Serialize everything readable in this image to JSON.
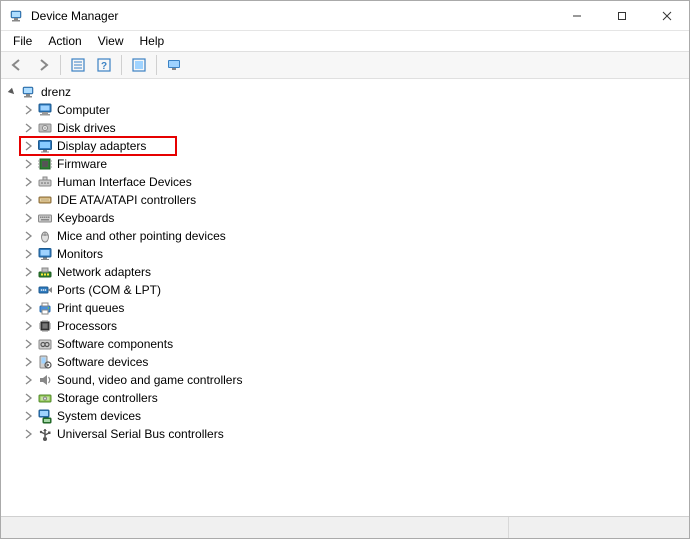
{
  "window": {
    "title": "Device Manager"
  },
  "menu": {
    "file": "File",
    "action": "Action",
    "view": "View",
    "help": "Help"
  },
  "tree": {
    "root": "drenz",
    "highlighted_index": 2,
    "items": [
      {
        "label": "Computer",
        "icon": "computer"
      },
      {
        "label": "Disk drives",
        "icon": "disk"
      },
      {
        "label": "Display adapters",
        "icon": "display"
      },
      {
        "label": "Firmware",
        "icon": "firmware"
      },
      {
        "label": "Human Interface Devices",
        "icon": "hid"
      },
      {
        "label": "IDE ATA/ATAPI controllers",
        "icon": "ide"
      },
      {
        "label": "Keyboards",
        "icon": "keyboard"
      },
      {
        "label": "Mice and other pointing devices",
        "icon": "mouse"
      },
      {
        "label": "Monitors",
        "icon": "monitor"
      },
      {
        "label": "Network adapters",
        "icon": "network"
      },
      {
        "label": "Ports (COM & LPT)",
        "icon": "port"
      },
      {
        "label": "Print queues",
        "icon": "printer"
      },
      {
        "label": "Processors",
        "icon": "cpu"
      },
      {
        "label": "Software components",
        "icon": "swcomp"
      },
      {
        "label": "Software devices",
        "icon": "swdev"
      },
      {
        "label": "Sound, video and game controllers",
        "icon": "sound"
      },
      {
        "label": "Storage controllers",
        "icon": "storage"
      },
      {
        "label": "System devices",
        "icon": "system"
      },
      {
        "label": "Universal Serial Bus controllers",
        "icon": "usb"
      }
    ]
  },
  "colors": {
    "highlight_border": "#e60000"
  }
}
